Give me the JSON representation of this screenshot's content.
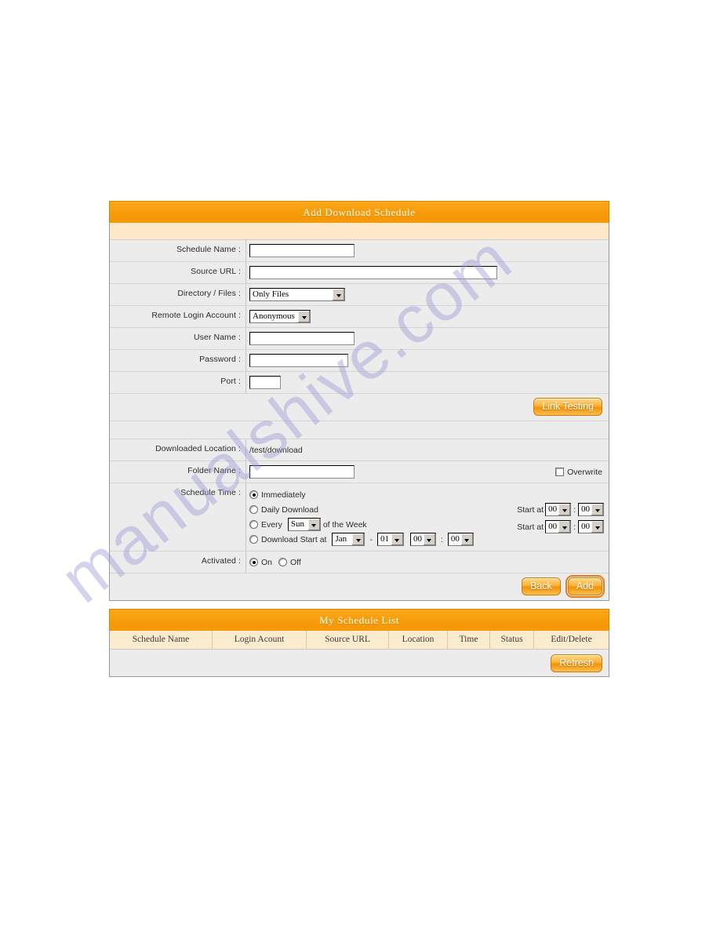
{
  "watermark": {
    "text": "manualshive.com"
  },
  "add_panel": {
    "title": "Add Download Schedule",
    "fields": {
      "schedule_name": {
        "label": "Schedule Name :",
        "value": "",
        "placeholder": ""
      },
      "source_url": {
        "label": "Source URL :",
        "value": "",
        "placeholder": ""
      },
      "directory_files": {
        "label": "Directory / Files :",
        "value": "Only Files",
        "options": [
          "Only Files"
        ]
      },
      "remote_login_account": {
        "label": "Remote Login Account :",
        "value": "Anonymous",
        "options": [
          "Anonymous"
        ]
      },
      "user_name": {
        "label": "User Name :",
        "value": "",
        "placeholder": ""
      },
      "password": {
        "label": "Password :",
        "value": "",
        "placeholder": ""
      },
      "port": {
        "label": "Port :",
        "value": "",
        "placeholder": ""
      },
      "downloaded_location": {
        "label": "Downloaded Location :",
        "value": "/test/download"
      },
      "folder_name": {
        "label": "Folder Name :",
        "value": "",
        "placeholder": ""
      },
      "overwrite": {
        "label": "Overwrite",
        "checked": false
      },
      "schedule_time": {
        "label": "Schedule Time :"
      },
      "activated": {
        "label": "Activated :",
        "on_label": "On",
        "off_label": "Off",
        "selected": "On"
      }
    },
    "schedule_options": {
      "immediately": {
        "label": "Immediately",
        "selected": true
      },
      "daily": {
        "label": "Daily Download",
        "selected": false
      },
      "weekly": {
        "label_before": "Every",
        "label_after": "of the Week",
        "day": "Sun",
        "day_options": [
          "Sun"
        ],
        "selected": false
      },
      "specific": {
        "label": "Download Start at",
        "month": "Jan",
        "day": "01",
        "hour": "00",
        "minute": "00",
        "separator": "-",
        "selected": false
      }
    },
    "start_times": [
      {
        "prefix": "Start at",
        "hour": "00",
        "minute": "00",
        "colon": ":"
      },
      {
        "prefix": "Start at",
        "hour": "00",
        "minute": "00",
        "colon": ":"
      }
    ],
    "buttons": {
      "link_testing": "Link Testing",
      "back": "Back",
      "add": "Add"
    }
  },
  "list_panel": {
    "title": "My Schedule List",
    "columns": [
      "Schedule Name",
      "Login Acount",
      "Source URL",
      "Location",
      "Time",
      "Status",
      "Edit/Delete"
    ],
    "rows": [],
    "refresh_label": "Refresh"
  }
}
